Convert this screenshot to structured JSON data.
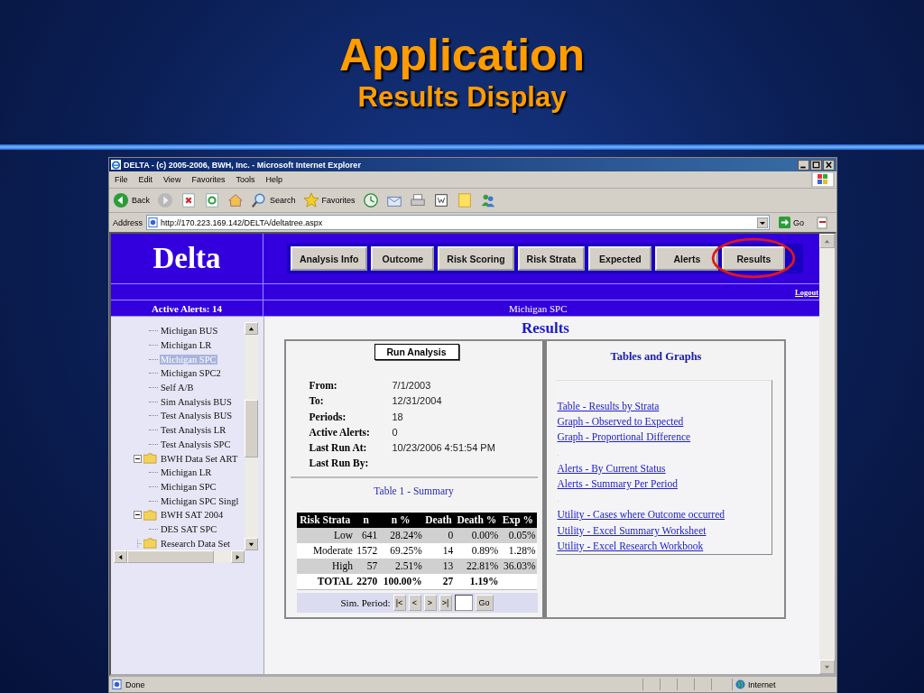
{
  "slide": {
    "title": "Application",
    "subtitle": "Results Display"
  },
  "window": {
    "title": "DELTA - (c) 2005-2006, BWH, Inc. - Microsoft Internet Explorer"
  },
  "menu": [
    "File",
    "Edit",
    "View",
    "Favorites",
    "Tools",
    "Help"
  ],
  "toolbar": [
    {
      "kind": "back",
      "label": "Back"
    },
    {
      "kind": "forward"
    },
    {
      "kind": "stop"
    },
    {
      "kind": "refresh"
    },
    {
      "kind": "home"
    },
    {
      "kind": "search",
      "label": "Search"
    },
    {
      "kind": "favorites",
      "label": "Favorites"
    },
    {
      "kind": "history"
    },
    {
      "kind": "mail"
    },
    {
      "kind": "print"
    },
    {
      "kind": "edit"
    },
    {
      "kind": "note"
    },
    {
      "kind": "messenger"
    }
  ],
  "address": {
    "label": "Address",
    "url": "http://170.223.169.142/DELTA/deltatree.aspx",
    "go": "Go"
  },
  "app": {
    "logo": "Delta",
    "logout": "Logout",
    "active_alerts": "Active Alerts: 14",
    "analysis": "Michigan SPC",
    "heading": "Results",
    "nav": [
      {
        "label": "Analysis Info",
        "highlighted": false
      },
      {
        "label": "Outcome",
        "highlighted": false
      },
      {
        "label": "Risk Scoring",
        "highlighted": false
      },
      {
        "label": "Risk Strata",
        "highlighted": false
      },
      {
        "label": "Expected",
        "highlighted": false
      },
      {
        "label": "Alerts",
        "highlighted": false
      },
      {
        "label": "Results",
        "highlighted": true
      }
    ]
  },
  "tree": [
    {
      "children": [
        {
          "label": "Michigan BUS",
          "selected": false
        },
        {
          "label": "Michigan LR",
          "selected": false
        },
        {
          "label": "Michigan SPC",
          "selected": true
        },
        {
          "label": "Michigan SPC2",
          "selected": false
        },
        {
          "label": "Self A/B",
          "selected": false
        },
        {
          "label": "Sim Analysis BUS",
          "selected": false
        },
        {
          "label": "Test Analysis BUS",
          "selected": false
        },
        {
          "label": "Test Analysis LR",
          "selected": false
        },
        {
          "label": "Test Analysis SPC",
          "selected": false
        }
      ]
    },
    {
      "label": "BWH Data Set ART",
      "selected": false,
      "children": [
        {
          "label": "Michigan LR",
          "selected": false
        },
        {
          "label": "Michigan SPC",
          "selected": false
        },
        {
          "label": "Michigan SPC Singl",
          "selected": false
        }
      ]
    },
    {
      "label": "BWH SAT 2004",
      "selected": false,
      "children": [
        {
          "label": "DES SAT SPC",
          "selected": false
        }
      ]
    },
    {
      "label": "Research Data Set",
      "selected": false
    }
  ],
  "run_button": "Run Analysis",
  "details": [
    {
      "label": "From:",
      "value": "7/1/2003"
    },
    {
      "label": "To:",
      "value": "12/31/2004"
    },
    {
      "label": "Periods:",
      "value": "18"
    },
    {
      "label": "Active Alerts:",
      "value": "0"
    },
    {
      "label": "Last Run At:",
      "value": "10/23/2006 4:51:54 PM"
    },
    {
      "label": "Last Run By:"
    }
  ],
  "summary": {
    "caption": "Table 1 - Summary",
    "columns": [
      "Risk Strata",
      "n",
      "n %",
      "Death",
      "Death %",
      "Exp %"
    ],
    "rows": [
      {
        "kind": "stratum",
        "cells": [
          "Low",
          "641",
          "28.24%",
          "0",
          "0.00%",
          "0.05%"
        ]
      },
      {
        "kind": "stratum",
        "cells": [
          "Moderate",
          "1572",
          "69.25%",
          "14",
          "0.89%",
          "1.28%"
        ]
      },
      {
        "kind": "stratum",
        "cells": [
          "High",
          "57",
          "2.51%",
          "13",
          "22.81%",
          "36.03%"
        ]
      },
      {
        "kind": "total",
        "cells": [
          "TOTAL",
          "2270",
          "100.00%",
          "27",
          "1.19%",
          ""
        ]
      }
    ]
  },
  "sim_period": {
    "label": "Sim. Period:",
    "buttons": [
      "|<",
      "<",
      ">",
      ">|"
    ],
    "go": "Go"
  },
  "tables_and_graphs": {
    "title": "Tables and Graphs",
    "links": [
      {
        "kind": "link",
        "text": "Table - Results by Strata"
      },
      {
        "kind": "link",
        "text": "Graph - Observed to Expected"
      },
      {
        "kind": "link",
        "text": "Graph - Proportional Difference"
      },
      {
        "kind": "separator",
        "text": "."
      },
      {
        "kind": "link",
        "text": "Alerts - By Current Status"
      },
      {
        "kind": "link",
        "text": "Alerts - Summary Per Period"
      },
      {
        "kind": "separator",
        "text": "."
      },
      {
        "kind": "link",
        "text": "Utility - Cases where Outcome occurred"
      },
      {
        "kind": "link",
        "text": "Utility - Excel Summary Worksheet"
      },
      {
        "kind": "link",
        "text": "Utility - Excel Research Workbook"
      }
    ]
  },
  "status_bar": {
    "text": "Done",
    "zone": "Internet"
  }
}
